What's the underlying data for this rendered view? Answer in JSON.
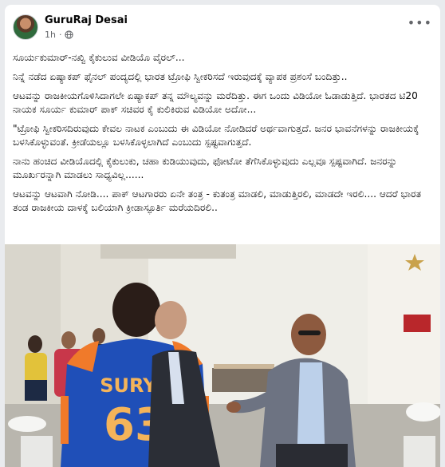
{
  "post": {
    "author": "GuruRaj Desai",
    "time": "1h",
    "more_icon": "more-options-icon",
    "privacy_icon": "globe-icon",
    "paragraphs": [
      "ಸೂರ್ಯಕುಮಾರ್-ನಖ್ವಿ ಕೈಕುಲುವ ವೀಡಿಯೊ ವೈರಲ್...",
      "ನಿನ್ನೆ ನಡೆದ ಏಷ್ಯಾಕಪ್ ಫೈನಲ್ ಪಂದ್ಯದಲ್ಲಿ ಭಾರತ ಟ್ರೋಫಿ ಸ್ವೀಕರಿಸದೆ ಇರುವುದಕ್ಕೆ ವ್ಯಾಪಕ ಪ್ರಶಂಸೆ ಬಂದಿತ್ತು..",
      "ಆಟವನ್ನು ರಾಜಕೀಯಗೊಳಿಸಿದಾಗಲೇ ಏಷ್ಯಾಕಪ್ ತನ್ನ ಮೌಲ್ಯವನ್ನು ಮರೆದಿತ್ತು. ಈಗ ಒಂದು ವಿಡಿಯೋ ಓಡಾಡುತ್ತಿದೆ. ಭಾರತದ ಟಿ20 ನಾಯಕ ಸೂರ್ಯ ಕುಮಾರ್ ಪಾಕ್ ಸಚಿವರ ಕೈ ಕುಲಿಕಿರುವ ವಿಡಿಯೋ ಅದೋ...",
      "\"ಟ್ರೋಫಿ ಸ್ವೀಕರಿಸದಿರುವುದು ಕೇವಲ ನಾಟಕ ಎಂಬುದು ಈ ವಿಡಿಯೋ ನೋಡಿದರೆ ಅರ್ಥವಾಗುತ್ತದೆ. ಜನರ ಭಾವನೆಗಳನ್ನು ರಾಜಕೀಯಕ್ಕೆ ಬಳಸಿಕೊಳ್ಳುವಂತೆ. ಕ್ರೀಡೆಯಲ್ಲೂ ಬಳಸಿಕೊಳ್ಳಲಾಗಿದೆ ಎಂಬುದು ಸ್ಪಷ್ಟವಾಗುತ್ತದೆ.",
      "ನಾನು ಹಂಚಿದ ವೀಡಿಯೊದಲ್ಲಿ ಕೈಕುಲುಕು, ಚಹಾ ಕುಡಿಯುವುದು, ಫೋಟೋ ತೆಗೆಸಿಕೊಳ್ಳುವುದು ಎಲ್ಲವೂ ಸ್ಪಷ್ಟವಾಗಿದೆ. ಜನರನ್ನು ಮೂರ್ಖರನ್ನಾಗಿ ಮಾಡಲು ಸಾಧ್ಯವಿಲ್ಲ......",
      "ಆಟವನ್ನು ಆಟವಾಗಿ ನೋಡಿ.... ಪಾಕ್ ಆಟಗಾರರು ಏನೇ ತಂತ್ರ - ಕುತಂತ್ರ ಮಾಡಲಿ, ಮಾಡುತ್ತಿರಲಿ, ಮಾಡದೇ ಇರಲಿ.... ಆದರೆ ಭಾರತ ತಂಡ ರಾಜಕೀಯ ದಾಳಕ್ಕೆ ಬಲಿಯಾಗಿ ಕ್ರೀಡಾಸ್ಫೂರ್ತಿ ಮರೆಯದಿರಲಿ.."
    ]
  },
  "photo": {
    "jersey_name": "SURYA",
    "jersey_number": "63",
    "colors": {
      "jersey_blue": "#1f4fb8",
      "jersey_orange": "#f07a2a",
      "wall": "#efeee8",
      "suit_grey": "#6d7382",
      "suit_dark": "#2b2e36"
    }
  }
}
